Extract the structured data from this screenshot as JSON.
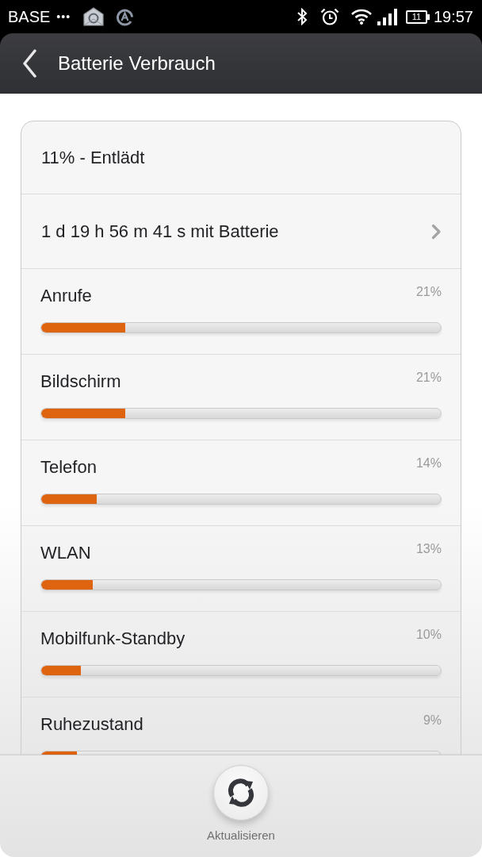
{
  "status_bar": {
    "carrier": "BASE",
    "more_indicator": "•••",
    "battery": "11",
    "time": "19:57"
  },
  "header": {
    "title": "Batterie Verbrauch"
  },
  "summary": {
    "status": "11% - Entlädt",
    "duration": "1 d 19 h 56 m 41 s mit Batterie"
  },
  "usage": [
    {
      "name": "Anrufe",
      "percent": "21%",
      "level": 0.21
    },
    {
      "name": "Bildschirm",
      "percent": "21%",
      "level": 0.21
    },
    {
      "name": "Telefon",
      "percent": "14%",
      "level": 0.138
    },
    {
      "name": "WLAN",
      "percent": "13%",
      "level": 0.128
    },
    {
      "name": "Mobilfunk-Standby",
      "percent": "10%",
      "level": 0.099
    },
    {
      "name": "Ruhezustand",
      "percent": "9%",
      "level": 0.089
    }
  ],
  "bottom_bar": {
    "refresh_label": "Aktualisieren"
  }
}
